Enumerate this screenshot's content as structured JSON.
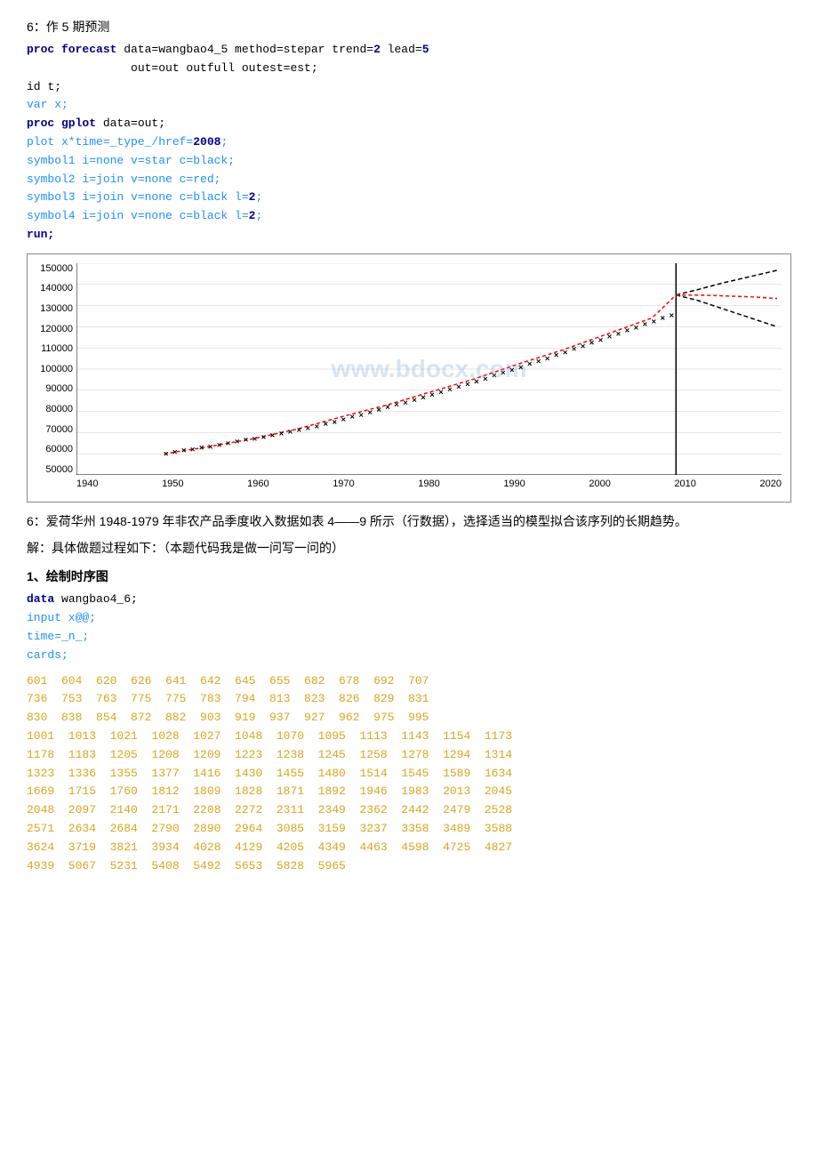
{
  "section6_title": "6：作 5 期预测",
  "code_block_1": {
    "lines": [
      {
        "type": "code",
        "content": "proc forecast",
        "rest": " data=wangbao4_5 method=stepar trend=",
        "bold_val": "2",
        "rest2": " lead=",
        "bold_val2": "5"
      },
      {
        "type": "indent",
        "content": "out=out outfull outest=est;"
      },
      {
        "type": "plain",
        "content": "id t;"
      },
      {
        "type": "plain_blue",
        "content": "var x;"
      },
      {
        "type": "code2",
        "content": "proc gplot",
        "rest": " data=out;"
      },
      {
        "type": "blue",
        "content": "plot x*time=_type_/href=",
        "bold_val": "2008",
        "rest": ";"
      },
      {
        "type": "blue",
        "content": "symbol1 i=none v=star c=black;"
      },
      {
        "type": "blue",
        "content": "symbol2 i=join v=none c=red;"
      },
      {
        "type": "blue",
        "content": "symbol3 i=join v=none c=black l=",
        "bold_val": "2",
        "rest": ";"
      },
      {
        "type": "blue",
        "content": "symbol4 i=join v=none c=black l=",
        "bold_val": "2",
        "rest": ";"
      },
      {
        "type": "bold_kw",
        "content": "run;"
      }
    ]
  },
  "chart": {
    "y_labels": [
      "150000",
      "140000",
      "130000",
      "120000",
      "110000",
      "100000",
      "90000",
      "80000",
      "70000",
      "60000",
      "50000"
    ],
    "x_labels": [
      "1940",
      "1950",
      "1960",
      "1970",
      "1980",
      "1990",
      "2000",
      "2010",
      "2020"
    ],
    "watermark": "www.bdocx.com"
  },
  "section6b_title": "6：爱荷华州 1948-1979 年非农产品季度收入数据如表 4——9 所示（行数据），选择适当的模型拟合该序列的长期趋势。",
  "solution_intro": "解：具体做题过程如下：（本题代码我是做一问写一问的）",
  "subsection1": "1、绘制时序图",
  "code_block_2": {
    "lines": [
      "data wangbao4_6;",
      "input x@@;",
      "time=_n_;",
      "cards;"
    ]
  },
  "data_rows": [
    "601  604  620  626  641  642  645  655  682  678  692  707",
    "736  753  763  775  775  783  794  813  823  826  829  831",
    "830  838  854  872  882  903  919  937  927  962  975  995",
    "1001  1013  1021  1028  1027  1048  1070  1095  1113  1143  1154  1173",
    "1178  1183  1205  1208  1209  1223  1238  1245  1258  1278  1294  1314",
    "1323  1336  1355  1377  1416  1430  1455  1480  1514  1545  1589  1634",
    "1669  1715  1760  1812  1809  1828  1871  1892  1946  1983  2013  2045",
    "2048  2097  2140  2171  2208  2272  2311  2349  2362  2442  2479  2528",
    "2571  2634  2684  2790  2890  2964  3085  3159  3237  3358  3489  3588",
    "3624  3719  3821  3934  4028  4129  4205  4349  4463  4598  4725  4827",
    "4939  5067  5231  5408  5492  5653  5828  5965"
  ]
}
